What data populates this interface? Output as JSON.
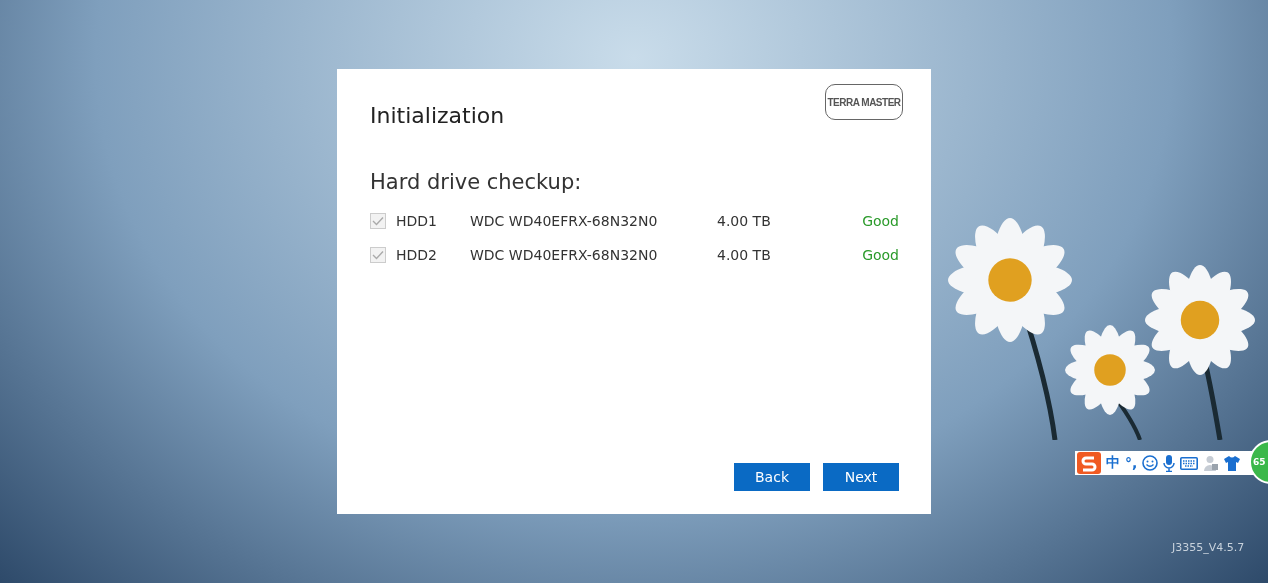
{
  "dialog": {
    "logo": "TERRA MASTER",
    "title": "Initialization",
    "section_title": "Hard drive checkup:",
    "drives": [
      {
        "name": "HDD1",
        "model": "WDC WD40EFRX-68N32N0",
        "capacity": "4.00 TB",
        "status": "Good",
        "checked": true,
        "disabled": true
      },
      {
        "name": "HDD2",
        "model": "WDC WD40EFRX-68N32N0",
        "capacity": "4.00 TB",
        "status": "Good",
        "checked": true,
        "disabled": true
      }
    ],
    "buttons": [
      "Back",
      "Next"
    ]
  },
  "ime_toolbar": {
    "mode": "中",
    "punctuation": "°,",
    "badge": "65"
  },
  "version": "J3355_V4.5.7"
}
